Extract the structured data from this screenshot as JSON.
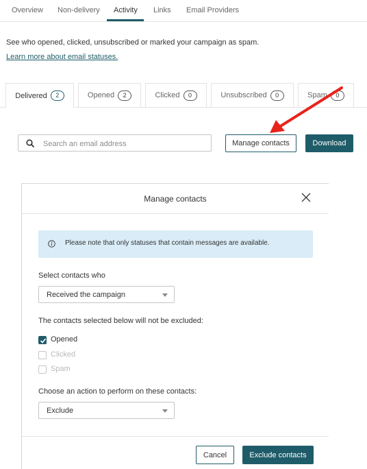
{
  "nav": {
    "tabs": [
      {
        "label": "Overview"
      },
      {
        "label": "Non-delivery"
      },
      {
        "label": "Activity"
      },
      {
        "label": "Links"
      },
      {
        "label": "Email Providers"
      }
    ],
    "active_tab": "Activity"
  },
  "intro": {
    "text": "See who opened, clicked, unsubscribed or marked your campaign as spam.",
    "link": "Learn more about email statuses."
  },
  "status_tabs": [
    {
      "label": "Delivered",
      "count": "2"
    },
    {
      "label": "Opened",
      "count": "2"
    },
    {
      "label": "Clicked",
      "count": "0"
    },
    {
      "label": "Unsubscribed",
      "count": "0"
    },
    {
      "label": "Spam",
      "count": "0"
    }
  ],
  "active_status_tab": "Delivered",
  "search": {
    "placeholder": "Search an email address",
    "icon": "search-icon"
  },
  "toolbar": {
    "manage_label": "Manage contacts",
    "download_label": "Download"
  },
  "modal": {
    "title": "Manage contacts",
    "info": "Please note that only statuses that contain messages are available.",
    "select_label": "Select contacts who",
    "select_value": "Received the campaign",
    "excluded_label": "The contacts selected below will not be excluded:",
    "options": [
      {
        "label": "Opened",
        "checked": true,
        "enabled": true
      },
      {
        "label": "Clicked",
        "checked": false,
        "enabled": false
      },
      {
        "label": "Spam",
        "checked": false,
        "enabled": false
      }
    ],
    "action_label": "Choose an action to perform on these contacts:",
    "action_value": "Exclude",
    "cancel_label": "Cancel",
    "confirm_label": "Exclude contacts"
  },
  "colors": {
    "accent": "#1f5c69",
    "info_bg": "#d9ecf7",
    "annotation_arrow": "#e8231c"
  }
}
